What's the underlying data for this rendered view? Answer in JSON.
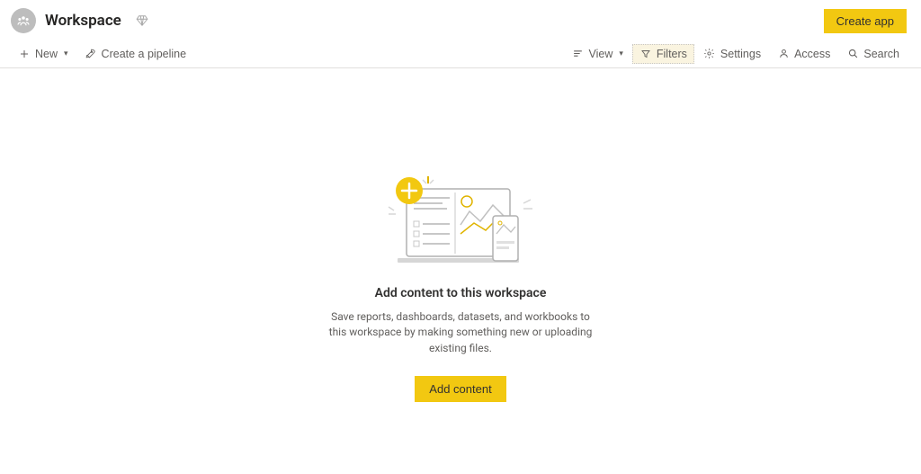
{
  "header": {
    "workspace_title": "Workspace",
    "create_app_label": "Create app"
  },
  "toolbar": {
    "new_label": "New",
    "create_pipeline_label": "Create a pipeline",
    "view_label": "View",
    "filters_label": "Filters",
    "settings_label": "Settings",
    "access_label": "Access",
    "search_label": "Search"
  },
  "empty_state": {
    "title": "Add content to this workspace",
    "description": "Save reports, dashboards, datasets, and workbooks to this workspace by making something new or uploading existing files.",
    "add_content_label": "Add content"
  },
  "colors": {
    "accent": "#f2c811",
    "gray_icon": "#605e5c"
  }
}
